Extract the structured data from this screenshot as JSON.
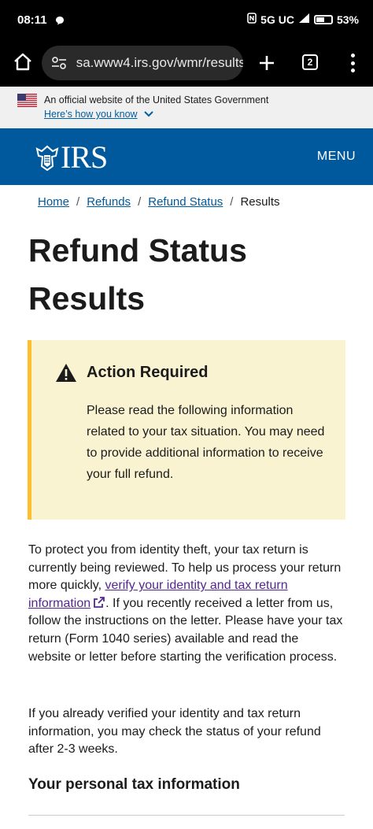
{
  "status_bar": {
    "time": "08:11",
    "network": "5G UC",
    "battery": "53%"
  },
  "browser": {
    "url": "sa.www4.irs.gov/wmr/results",
    "tab_count": "2"
  },
  "gov_banner": {
    "text": "An official website of the United States Government",
    "link": "Here’s how you know"
  },
  "header": {
    "logo_text": "IRS",
    "menu_label": "MENU",
    "color": "#00599c"
  },
  "breadcrumb": {
    "home": "Home",
    "refunds": "Refunds",
    "refund_status": "Refund Status",
    "current": "Results",
    "sep": "/"
  },
  "page": {
    "title": "Refund Status Results"
  },
  "alert": {
    "heading": "Action Required",
    "body": "Please read the following information related to your tax situation. You may need to provide additional information to receive your full refund.",
    "background": "#faf3d1",
    "accent": "#ffbe2e"
  },
  "content": {
    "para1_before": "To protect you from identity theft, your tax return is currently being reviewed. To help us process your return more quickly, ",
    "para1_link": "verify your identity and tax return information",
    "para1_after": ". If you recently received a letter from us, follow the instructions on the letter. Please have your tax return (Form 1040 series) available and read the website or letter before starting the verification process.",
    "para2": "If you already verified your identity and tax return information, you may check the status of your refund after 2-3 weeks.",
    "section_heading": "Your personal tax information"
  }
}
